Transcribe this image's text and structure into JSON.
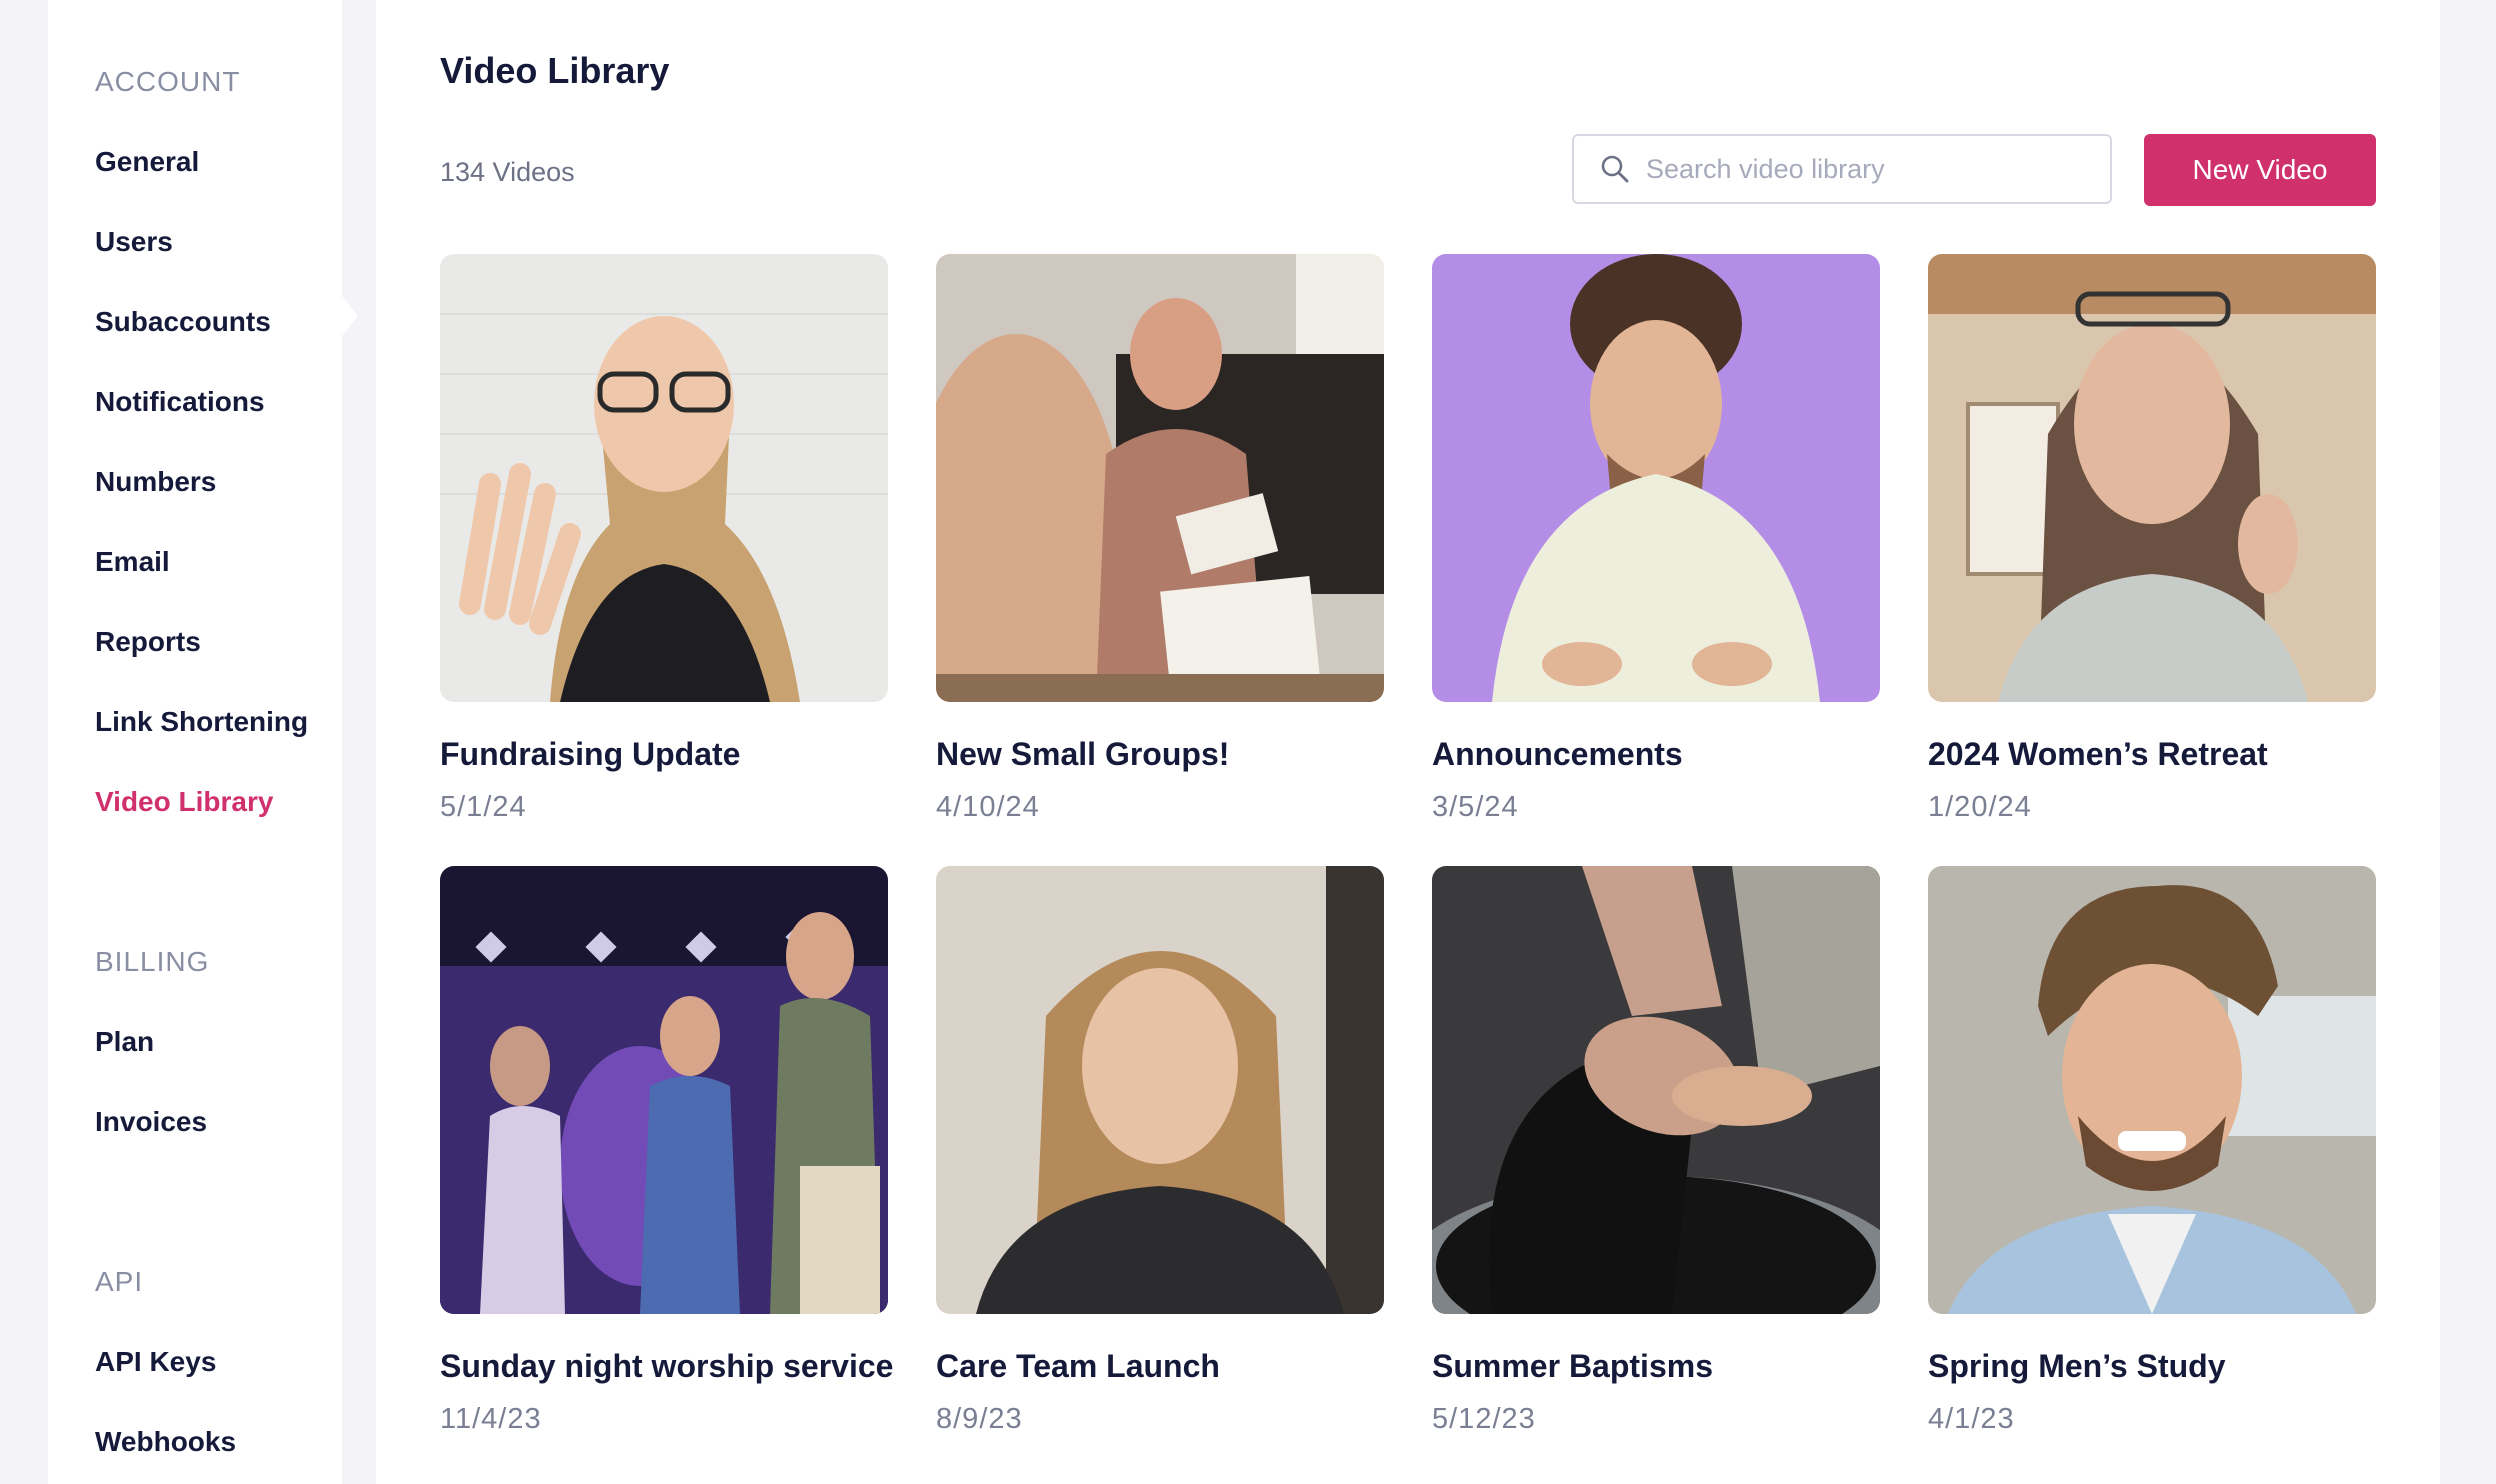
{
  "sidebar": {
    "sections": [
      {
        "header": "ACCOUNT",
        "items": [
          {
            "label": "General"
          },
          {
            "label": "Users"
          },
          {
            "label": "Subaccounts"
          },
          {
            "label": "Notifications"
          },
          {
            "label": "Numbers"
          },
          {
            "label": "Email"
          },
          {
            "label": "Reports"
          },
          {
            "label": "Link Shortening"
          },
          {
            "label": "Video Library",
            "active": true
          }
        ]
      },
      {
        "header": "BILLING",
        "items": [
          {
            "label": "Plan"
          },
          {
            "label": "Invoices"
          }
        ]
      },
      {
        "header": "API",
        "items": [
          {
            "label": "API Keys"
          },
          {
            "label": "Webhooks"
          }
        ]
      }
    ]
  },
  "main": {
    "title": "Video Library",
    "count": "134 Videos",
    "search": {
      "placeholder": "Search video library",
      "value": "",
      "icon": "search-icon"
    },
    "new_button": "New Video",
    "videos": [
      {
        "title": "Fundraising Update",
        "date": "5/1/24",
        "thumb": "woman-waving-glasses"
      },
      {
        "title": "New Small Groups!",
        "date": "4/10/24",
        "thumb": "man-reading-bible"
      },
      {
        "title": "Announcements",
        "date": "3/5/24",
        "thumb": "man-purple-background"
      },
      {
        "title": "2024 Women’s  Retreat",
        "date": "1/20/24",
        "thumb": "older-woman-speaking"
      },
      {
        "title": "Sunday night worship service",
        "date": "11/4/23",
        "thumb": "worship-band-stage"
      },
      {
        "title": "Care Team Launch",
        "date": "8/9/23",
        "thumb": "woman-portrait"
      },
      {
        "title": "Summer Baptisms",
        "date": "5/12/23",
        "thumb": "baptism"
      },
      {
        "title": "Spring Men’s Study",
        "date": "4/1/23",
        "thumb": "man-smiling-denim"
      }
    ]
  },
  "colors": {
    "accent": "#d0306b",
    "text": "#161a3a",
    "muted": "#7b7f94",
    "background": "#f4f4f8"
  }
}
